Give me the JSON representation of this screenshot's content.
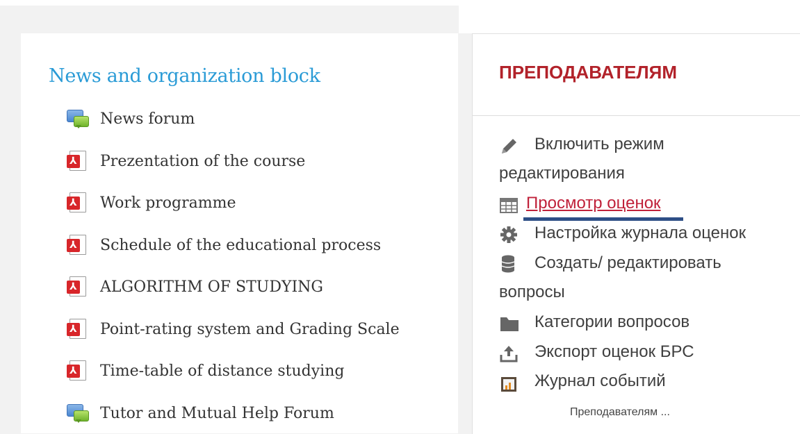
{
  "left_block": {
    "title": "News and organization block",
    "activities": [
      {
        "type": "forum",
        "label": "News forum"
      },
      {
        "type": "pdf",
        "label": "Prezentation of the course"
      },
      {
        "type": "pdf",
        "label": "Work programme"
      },
      {
        "type": "pdf",
        "label": "Schedule of the educational process"
      },
      {
        "type": "pdf",
        "label": "ALGORITHM OF STUDYING"
      },
      {
        "type": "pdf",
        "label": "Point-rating system and Grading Scale"
      },
      {
        "type": "pdf",
        "label": "Time-table of distance studying"
      },
      {
        "type": "forum",
        "label": "Tutor and Mutual Help Forum"
      }
    ]
  },
  "right_block": {
    "title": "ПРЕПОДАВАТЕЛЯМ",
    "items": [
      {
        "icon": "pencil-icon",
        "label_line1": "Включить режим",
        "label_line2": "редактирования"
      },
      {
        "icon": "table-icon",
        "label_line1": " Просмотр оценок"
      },
      {
        "icon": "gear-icon",
        "label_line1": "Настройка журнала оценок"
      },
      {
        "icon": "database-icon",
        "label_line1": "Создать/ редактировать",
        "label_line2": "вопросы"
      },
      {
        "icon": "folder-icon",
        "label_line1": "Категории вопросов"
      },
      {
        "icon": "upload-icon",
        "label_line1": "Экспорт оценок БРС"
      },
      {
        "icon": "log-icon",
        "label_line1": "Журнал событий"
      }
    ],
    "footer": "Преподавателям ..."
  },
  "colors": {
    "left_title": "#2a9bd6",
    "right_title": "#b2222a",
    "link": "#c0213a",
    "highlight_bar": "#2e4f86"
  }
}
